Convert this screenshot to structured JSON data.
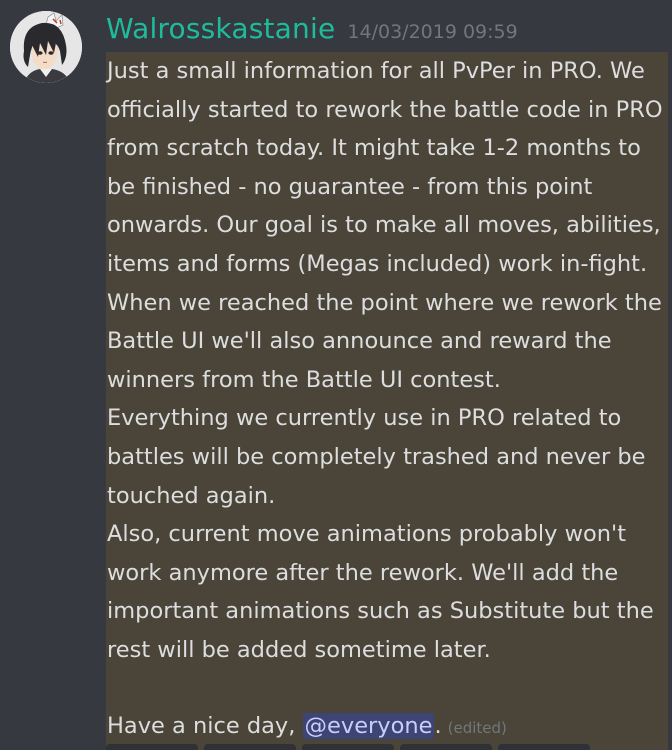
{
  "message": {
    "author": "Walrosskastanie",
    "timestamp": "14/03/2019 09:59",
    "lines": [
      "Just a small information for all PvPer in PRO. We",
      "officially started to rework the battle code in PRO",
      "from scratch today. It might take 1-2 months to",
      "be finished - no guarantee - from this point",
      "onwards. Our goal is to make all moves, abilities,",
      "items and forms (Megas included) work in-fight.",
      "When we reached the point where we rework the",
      "Battle UI we'll also announce and reward the",
      "winners from the Battle UI contest.",
      "Everything we currently use in PRO related to",
      "battles will be completely trashed and never be",
      "touched again.",
      "Also, current move animations probably won't",
      "work anymore after the rework. We'll add the",
      "important animations such as Substitute but the",
      "rest will be added sometime later."
    ],
    "closing_text": "Have a nice day, ",
    "mention": "@everyone",
    "closing_punct": ".",
    "edited_label": "(edited)"
  },
  "colors": {
    "background": "#36393f",
    "username": "#1fbc9c",
    "highlight": "#4b4539",
    "mention_bg": "#3d4575",
    "mention_text": "#c9cdfb"
  },
  "icons": {
    "avatar": "avatar-anime-character-with-fox-mask"
  }
}
